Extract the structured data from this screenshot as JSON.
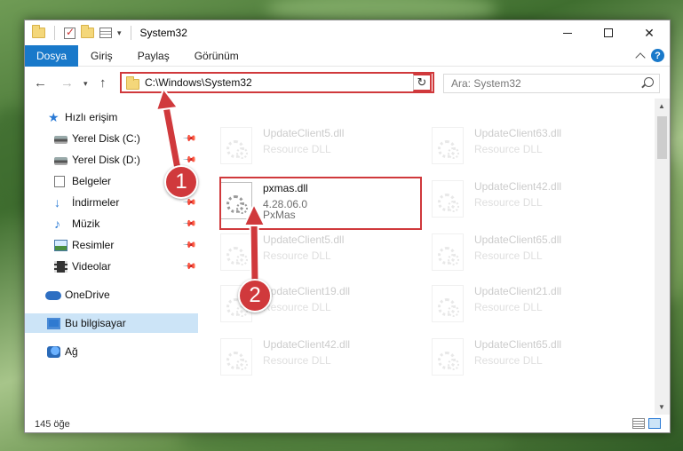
{
  "window": {
    "title": "System32",
    "controls": {
      "minimize": "minimize",
      "maximize": "maximize",
      "close": "✕"
    }
  },
  "ribbon": {
    "tabs": [
      "Dosya",
      "Giriş",
      "Paylaş",
      "Görünüm"
    ]
  },
  "address": {
    "path": "C:\\Windows\\System32",
    "search_placeholder": "Ara: System32"
  },
  "sidebar": {
    "items": [
      {
        "label": "Hızlı erişim",
        "icon": "star-icon",
        "pinned": false
      },
      {
        "label": "Yerel Disk (C:)",
        "icon": "disk-icon",
        "pinned": true
      },
      {
        "label": "Yerel Disk (D:)",
        "icon": "disk-icon",
        "pinned": true
      },
      {
        "label": "Belgeler",
        "icon": "documents-icon",
        "pinned": true
      },
      {
        "label": "İndirmeler",
        "icon": "downloads-icon",
        "pinned": true
      },
      {
        "label": "Müzik",
        "icon": "music-icon",
        "pinned": true
      },
      {
        "label": "Resimler",
        "icon": "pictures-icon",
        "pinned": true
      },
      {
        "label": "Videolar",
        "icon": "videos-icon",
        "pinned": true
      },
      {
        "label": "OneDrive",
        "icon": "onedrive-icon",
        "pinned": false
      },
      {
        "label": "Bu bilgisayar",
        "icon": "this-pc-icon",
        "pinned": false,
        "selected": true
      },
      {
        "label": "Ağ",
        "icon": "network-icon",
        "pinned": false
      }
    ]
  },
  "files": [
    {
      "name": "UpdateClient5.dll",
      "desc": "Resource DLL",
      "faded": true
    },
    {
      "name": "UpdateClient63.dll",
      "desc": "Resource DLL",
      "faded": true
    },
    {
      "name": "pxmas.dll",
      "desc": "4.28.06.0",
      "sub": "PxMas",
      "faded": false,
      "highlighted": true
    },
    {
      "name": "UpdateClient42.dll",
      "desc": "Resource DLL",
      "faded": true
    },
    {
      "name": "UpdateClient5.dll",
      "desc": "Resource DLL",
      "faded": true
    },
    {
      "name": "UpdateClient65.dll",
      "desc": "Resource DLL",
      "faded": true
    },
    {
      "name": "UpdateClient19.dll",
      "desc": "Resource DLL",
      "faded": true
    },
    {
      "name": "UpdateClient21.dll",
      "desc": "Resource DLL",
      "faded": true
    },
    {
      "name": "UpdateClient42.dll",
      "desc": "Resource DLL",
      "faded": true
    },
    {
      "name": "UpdateClient65.dll",
      "desc": "Resource DLL",
      "faded": true
    }
  ],
  "status": {
    "count": "145 öğe"
  },
  "annotations": {
    "step1": "1",
    "step2": "2"
  },
  "colors": {
    "accent": "#1979ca",
    "highlight": "#d0393c",
    "selected_bg": "#cce4f7"
  }
}
